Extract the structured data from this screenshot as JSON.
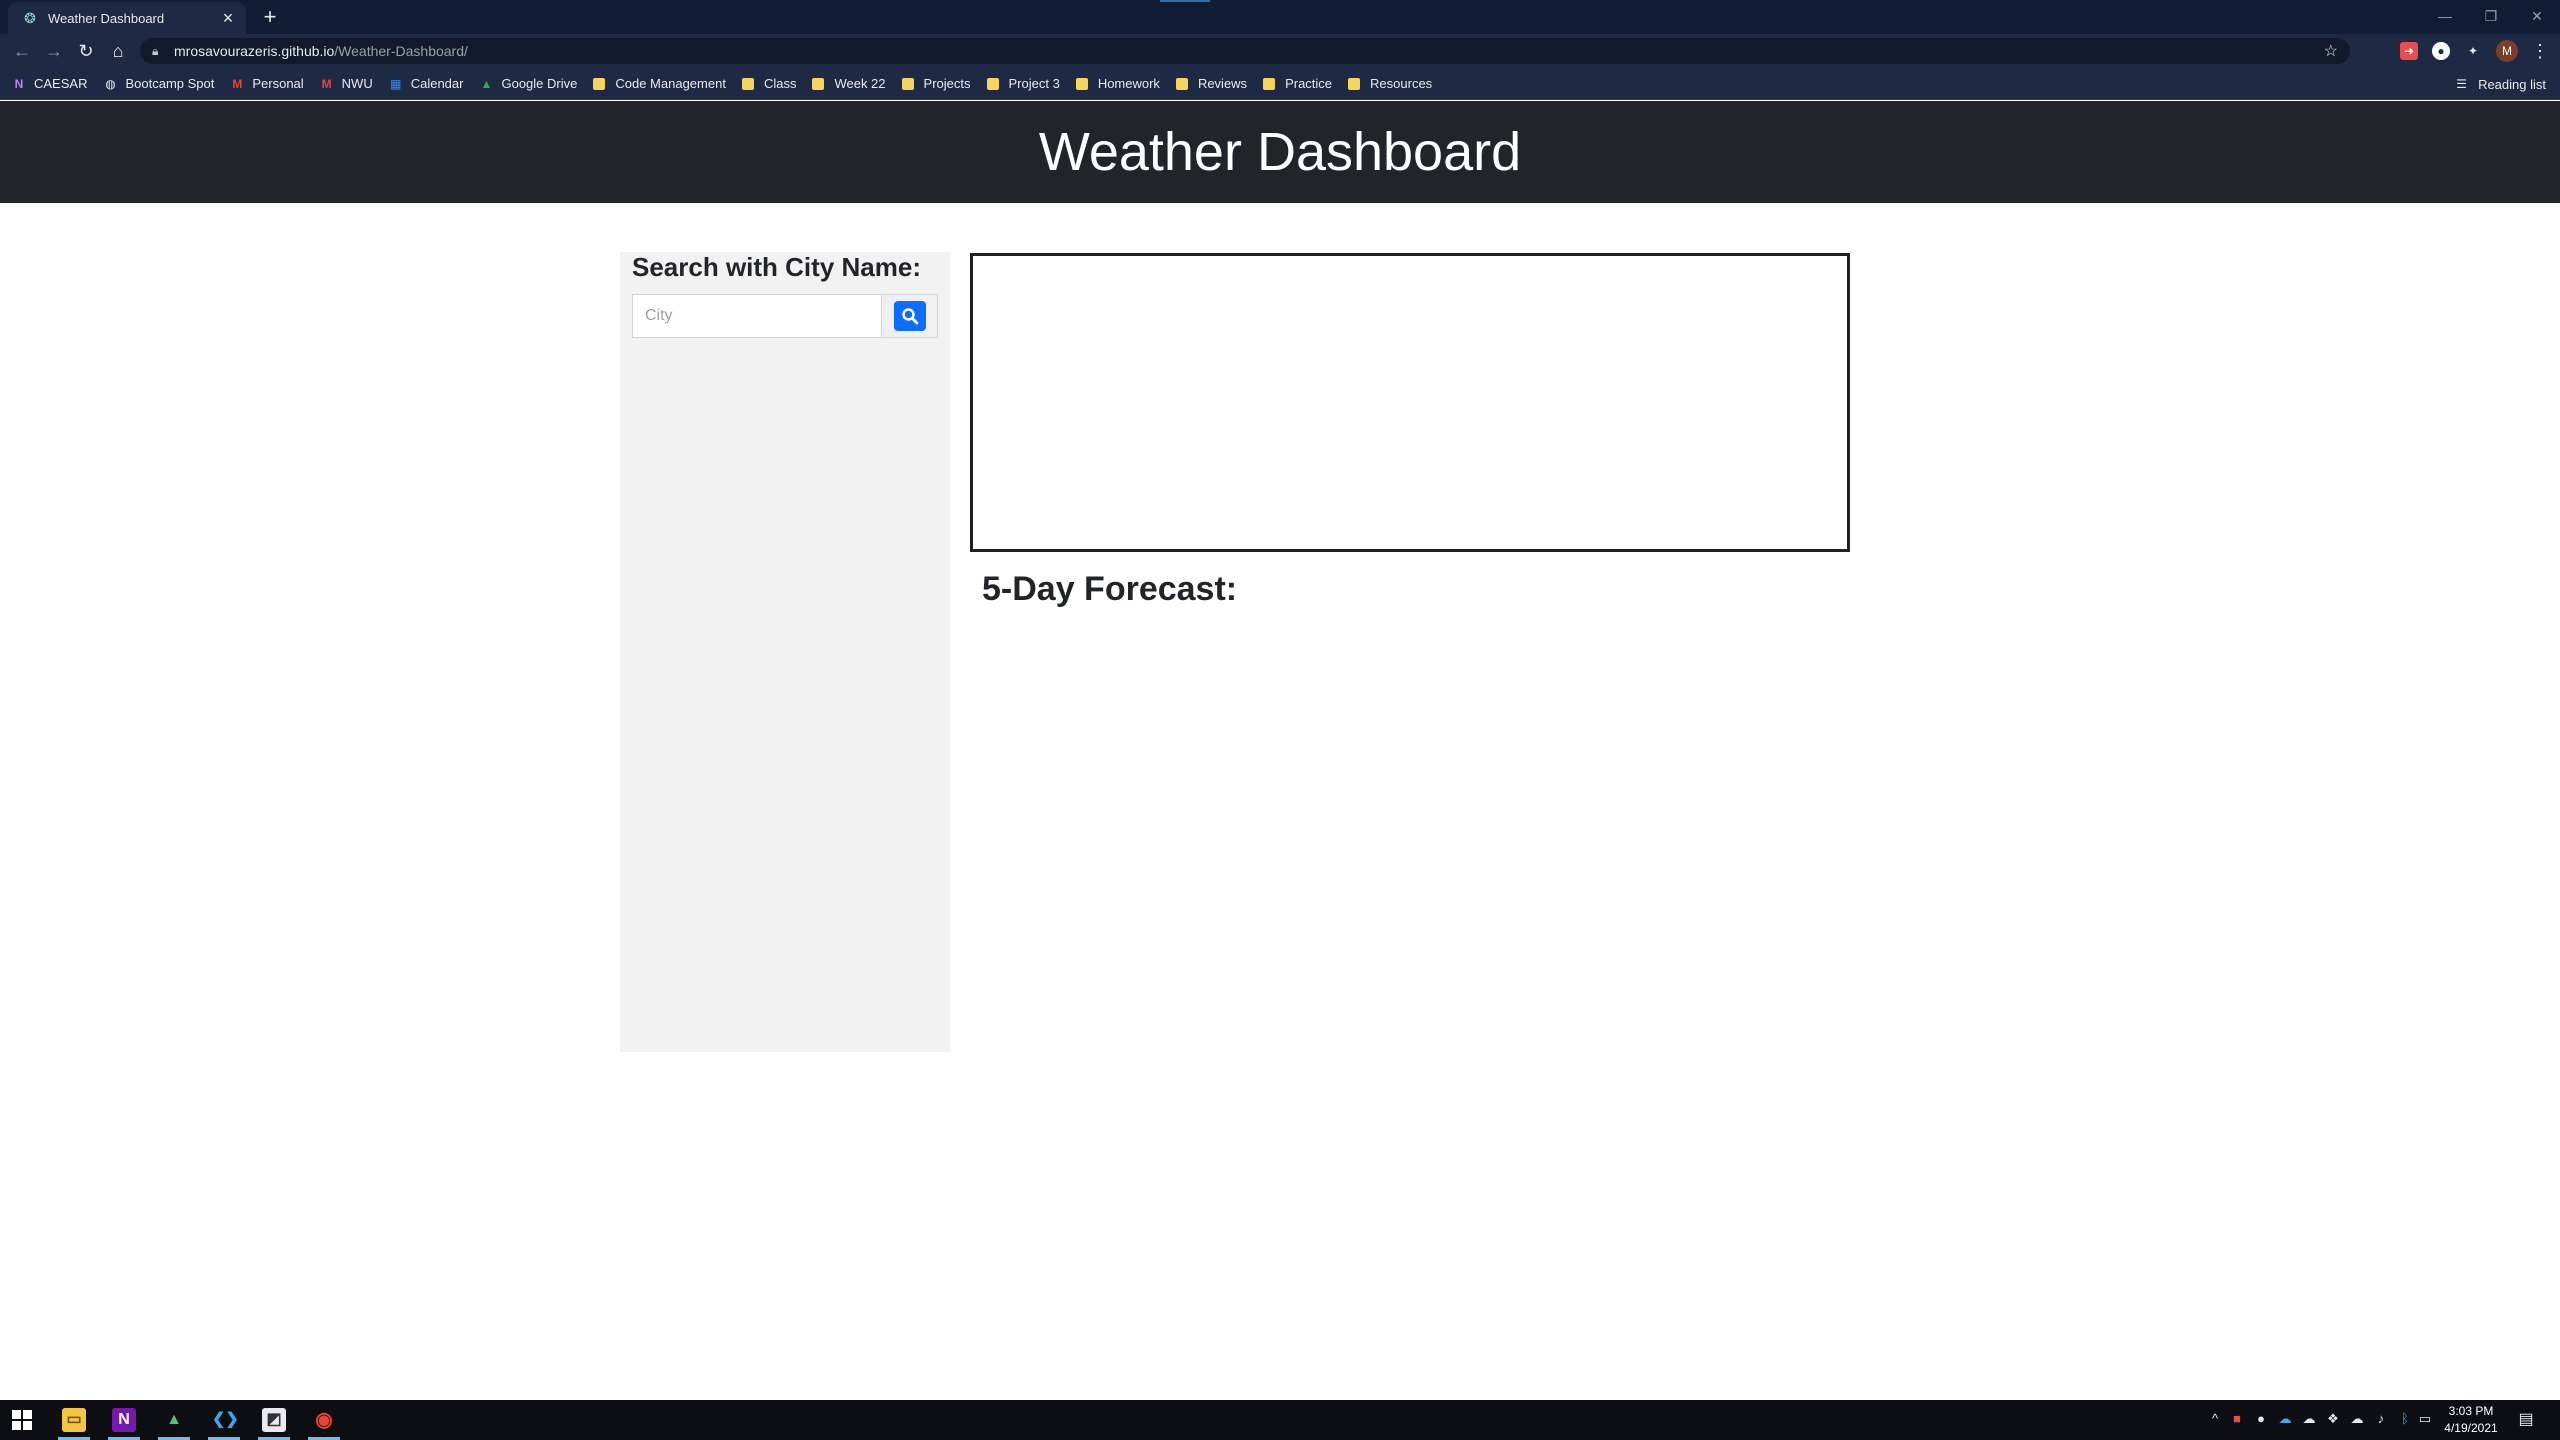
{
  "browser": {
    "tab": {
      "title": "Weather Dashboard",
      "close_glyph": "×"
    },
    "new_tab_glyph": "+",
    "window_controls": {
      "minimize": "—",
      "restore": "❐",
      "close": "✕"
    },
    "nav": {
      "back": "←",
      "forward": "→",
      "reload": "↻",
      "home": "⌂"
    },
    "address": {
      "host": "mrosavourazeris.github.io",
      "path": "/Weather-Dashboard/"
    },
    "bookmarks": [
      {
        "label": "CAESAR",
        "icon": "onenote-icon"
      },
      {
        "label": "Bootcamp Spot",
        "icon": "globe-icon"
      },
      {
        "label": "Personal",
        "icon": "gmail-icon"
      },
      {
        "label": "NWU",
        "icon": "gmail-icon"
      },
      {
        "label": "Calendar",
        "icon": "calendar-icon"
      },
      {
        "label": "Google Drive",
        "icon": "drive-icon"
      },
      {
        "label": "Code Management",
        "icon": "folder-icon"
      },
      {
        "label": "Class",
        "icon": "folder-icon"
      },
      {
        "label": "Week 22",
        "icon": "folder-icon"
      },
      {
        "label": "Projects",
        "icon": "folder-icon"
      },
      {
        "label": "Project 3",
        "icon": "folder-icon"
      },
      {
        "label": "Homework",
        "icon": "folder-icon"
      },
      {
        "label": "Reviews",
        "icon": "folder-icon"
      },
      {
        "label": "Practice",
        "icon": "folder-icon"
      },
      {
        "label": "Resources",
        "icon": "folder-icon"
      }
    ],
    "reading_list": "Reading list",
    "profile_initial": "M"
  },
  "page": {
    "header_title": "Weather Dashboard",
    "search": {
      "label": "Search with City Name:",
      "placeholder": "City",
      "value": ""
    },
    "forecast_title": "5-Day Forecast:"
  },
  "taskbar": {
    "time": "3:03 PM",
    "date": "4/19/2021"
  },
  "colors": {
    "header_bg": "#212429",
    "sidebar_bg": "#f2f2f2",
    "search_button": "#0d6efd",
    "browser_frame": "#1e2a44"
  }
}
